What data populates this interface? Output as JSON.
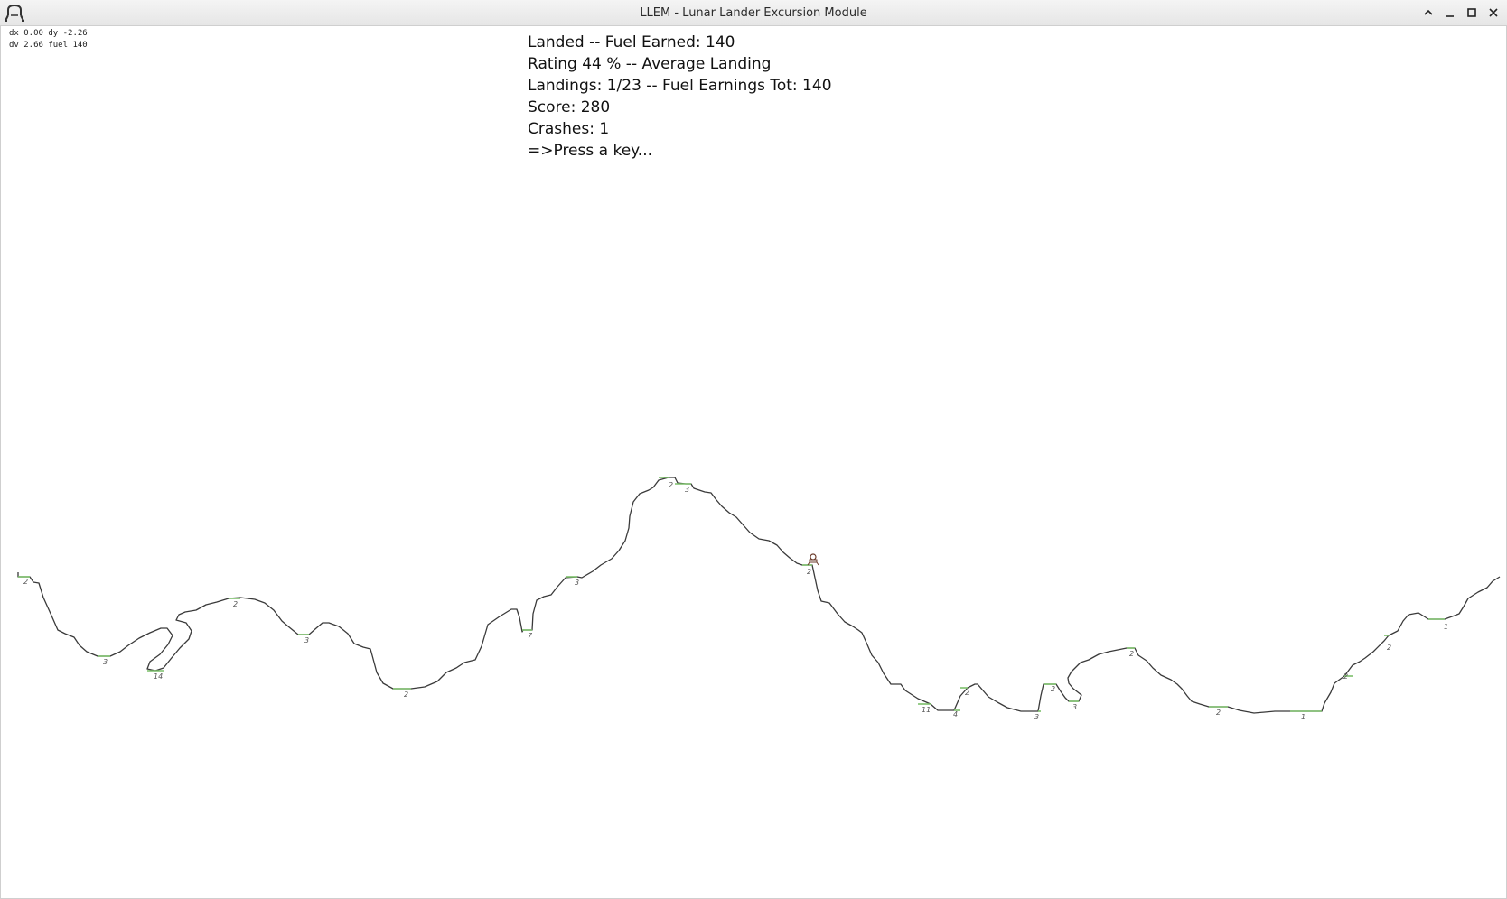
{
  "window": {
    "title": "LLEM - Lunar Lander Excursion Module",
    "app_icon": "lander-icon",
    "controls": [
      "chevron-up-icon",
      "minimize-icon",
      "maximize-icon",
      "close-icon"
    ]
  },
  "telemetry": {
    "line1": "dx 0.00 dy -2.26",
    "line2": "dv 2.66 fuel 140"
  },
  "status": {
    "line1": "Landed -- Fuel Earned: 140",
    "line2": "Rating 44 % -- Average Landing",
    "line3": "Landings: 1/23 -- Fuel Earnings Tot: 140",
    "line4": "Score: 280",
    "line5": "Crashes: 1",
    "line6": "=>Press a key..."
  },
  "pad_multipliers": [
    "2",
    "3",
    "14",
    "2",
    "3",
    "2",
    "7",
    "3",
    "2",
    "3",
    "2",
    "4",
    "3",
    "2",
    "3",
    "2",
    "11",
    "2",
    "2",
    "1",
    "2",
    "2",
    "1"
  ],
  "colors": {
    "terrain": "#3a3a3a",
    "landing_pad": "#7bbf6a",
    "pad_label": "#555555"
  }
}
